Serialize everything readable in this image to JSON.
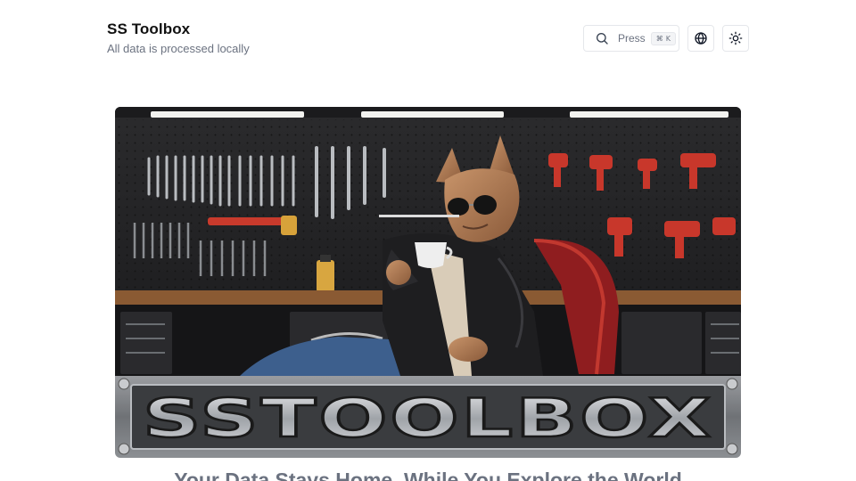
{
  "header": {
    "title": "SS Toolbox",
    "subtitle": "All data is processed locally"
  },
  "search": {
    "label": "Press",
    "shortcut_symbol": "⌘",
    "shortcut_key": "K",
    "icon": "search-icon"
  },
  "buttons": {
    "language_icon": "globe-icon",
    "theme_icon": "sun-icon"
  },
  "hero": {
    "banner_text": "SSTOOLBOX",
    "description": "cat in leather jacket and sunglasses drinking coffee in a workshop"
  },
  "main": {
    "headline": "Your Data Stays Home, While You Explore the World"
  },
  "colors": {
    "accent_text": "#6b7280",
    "border": "#e5e7eb"
  }
}
